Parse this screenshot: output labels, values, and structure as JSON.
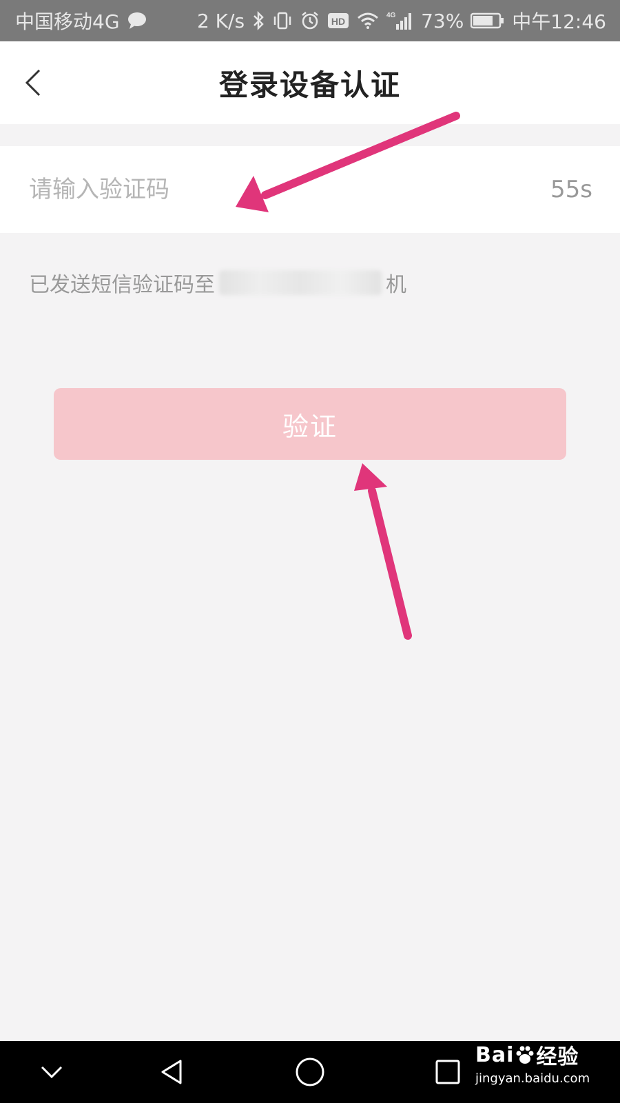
{
  "status_bar": {
    "carrier": "中国移动4G",
    "speed": "2 K/s",
    "hd_label": "HD",
    "network_label": "4G",
    "battery": "73%",
    "time": "中午12:46"
  },
  "header": {
    "title": "登录设备认证"
  },
  "code_field": {
    "placeholder": "请输入验证码",
    "countdown": "55s"
  },
  "sms_hint": {
    "prefix": "已发送短信验证码至",
    "suffix": "机"
  },
  "verify_button": {
    "label": "验证"
  },
  "colors": {
    "button_disabled": "#f6c6cb",
    "annotation_arrow": "#e0357a",
    "page_background": "#f4f3f4"
  },
  "watermark": {
    "brand_a": "Bai",
    "brand_b": "经验",
    "url": "jingyan.baidu.com"
  }
}
